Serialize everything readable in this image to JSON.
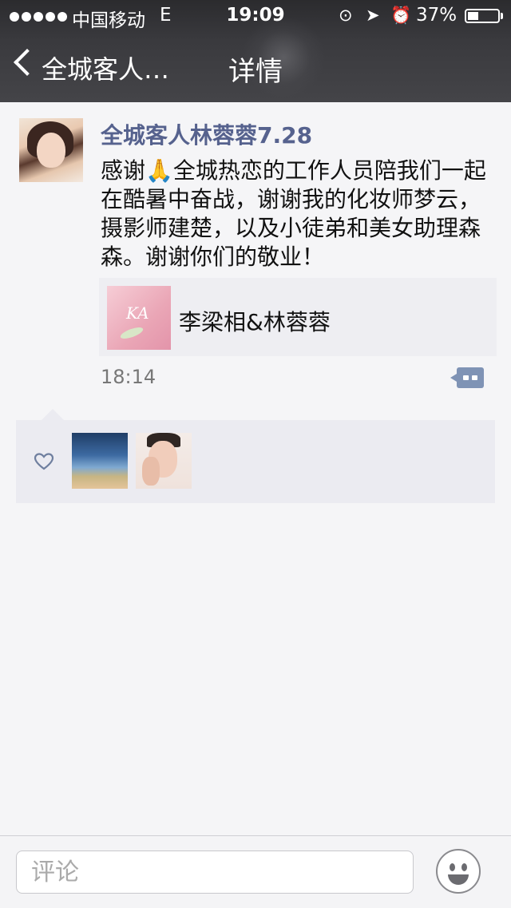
{
  "status_bar": {
    "carrier": "中国移动",
    "network": "E",
    "time": "19:09",
    "battery_percent_label": "37%",
    "battery_level": 0.37,
    "icons": [
      "signal-dots-icon",
      "rotation-lock-icon",
      "location-arrow-icon",
      "alarm-icon",
      "battery-icon"
    ]
  },
  "nav": {
    "back_label": "全城客人…",
    "title": "详情"
  },
  "post": {
    "author": "全城客人林蓉蓉7.28",
    "text": "感谢🙏全城热恋的工作人员陪我们一起在酷暑中奋战，谢谢我的化妆师梦云，摄影师建楚，以及小徒弟和美女助理森森。谢谢你们的敬业！",
    "link_card": {
      "title": "李梁相&林蓉蓉",
      "thumb_text": "KA"
    },
    "time": "18:14"
  },
  "likes": {
    "icon": "heart-icon",
    "count": 2
  },
  "comment_bar": {
    "placeholder": "评论",
    "emoji_icon": "smiley-icon"
  },
  "colors": {
    "author_blue": "#56628e",
    "comment_button": "#7f93b5",
    "page_bg": "#f5f5f7"
  }
}
